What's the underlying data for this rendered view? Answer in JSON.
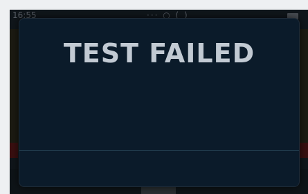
{
  "status_bar": {
    "time": "16:55",
    "icons": "··· ○ ( )",
    "battery_icon": "battery-icon"
  },
  "dialog": {
    "title": "TEST FAILED"
  },
  "colors": {
    "dialog_bg": "#0b1b2a",
    "dialog_title": "#c2cad3",
    "divider": "#244052"
  }
}
